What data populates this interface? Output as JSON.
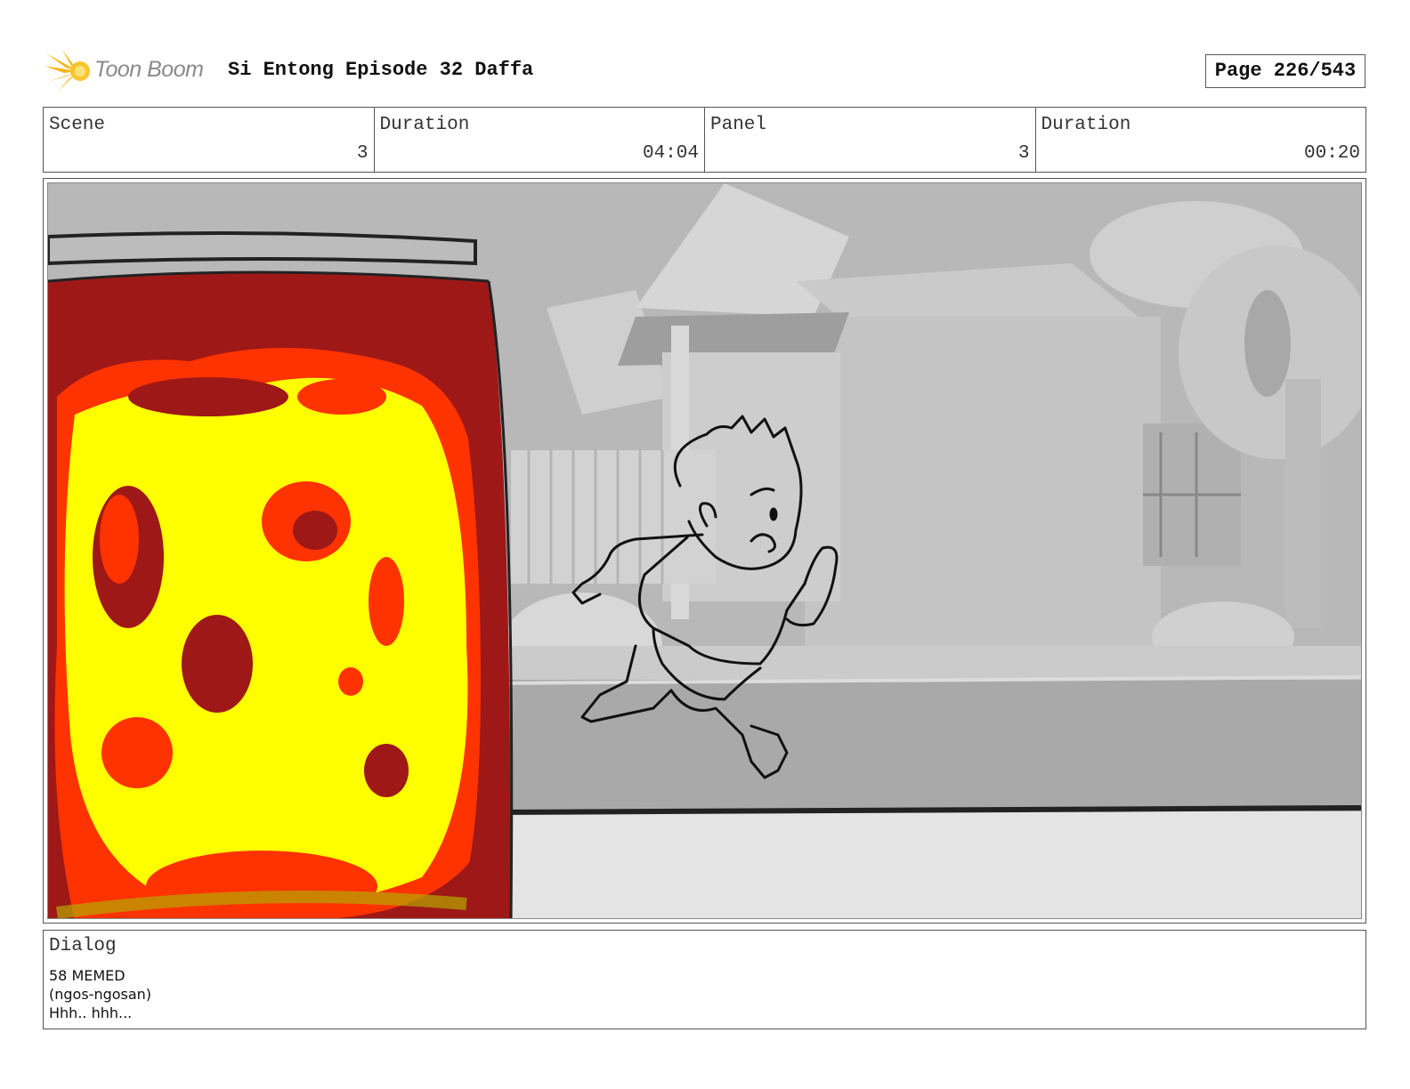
{
  "header": {
    "logo_text": "Toon Boom",
    "title": "Si Entong Episode 32 Daffa",
    "page": "Page 226/543"
  },
  "info": {
    "scene_label": "Scene",
    "scene_value": "3",
    "duration_label": "Duration",
    "duration_value": "04:04",
    "panel_label": "Panel",
    "panel_value": "3",
    "panel_duration_label": "Duration",
    "panel_duration_value": "00:20"
  },
  "dialog": {
    "label": "Dialog",
    "lines": [
      "58 MEMED",
      "(ngos-ngosan)",
      "Hhh.. hhh..."
    ]
  },
  "colors": {
    "logo_flame": "#f5b71c",
    "jar_dark_red": "#9e1818",
    "jar_orange": "#ff3300",
    "jar_yellow": "#ffff00",
    "background_gray": "#bdbdbd"
  },
  "icons": {
    "logo": "flame-burst-icon"
  }
}
